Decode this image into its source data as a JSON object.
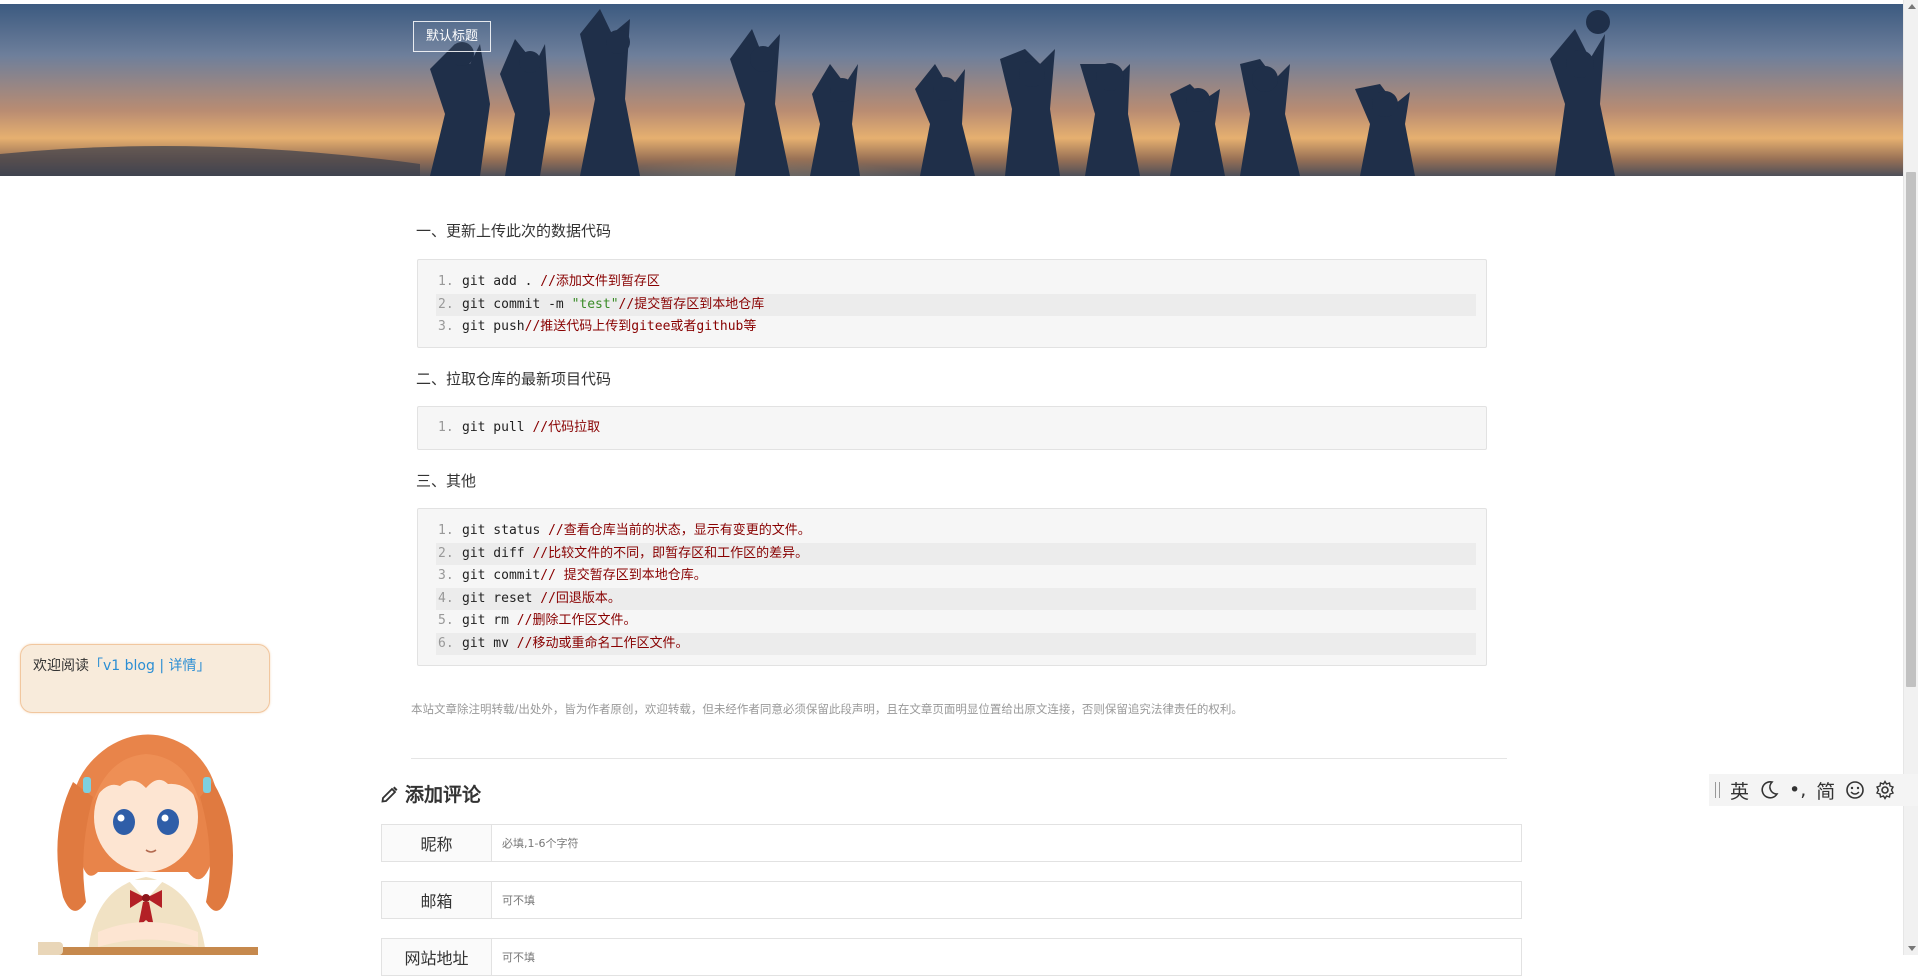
{
  "header": {
    "title_button": "默认标题"
  },
  "article": {
    "section1": {
      "heading": "一、更新上传此次的数据代码",
      "lines": [
        {
          "num": "1.",
          "code": "git add . ",
          "comment": "//添加文件到暂存区"
        },
        {
          "num": "2.",
          "code": "git commit -m ",
          "string": "\"test\"",
          "comment": "//提交暂存区到本地仓库"
        },
        {
          "num": "3.",
          "code": "git push",
          "comment": "//推送代码上传到gitee或者github等"
        }
      ]
    },
    "section2": {
      "heading": "二、拉取仓库的最新项目代码",
      "lines": [
        {
          "num": "1.",
          "code": "git pull ",
          "comment": "//代码拉取"
        }
      ]
    },
    "section3": {
      "heading": "三、其他",
      "lines": [
        {
          "num": "1.",
          "code": "git status ",
          "comment": "//查看仓库当前的状态，显示有变更的文件。"
        },
        {
          "num": "2.",
          "code": "git diff ",
          "comment": "//比较文件的不同，即暂存区和工作区的差异。"
        },
        {
          "num": "3.",
          "code": "git commit",
          "comment": "// 提交暂存区到本地仓库。"
        },
        {
          "num": "4.",
          "code": "git reset ",
          "comment": "//回退版本。"
        },
        {
          "num": "5.",
          "code": "git rm ",
          "comment": "//删除工作区文件。"
        },
        {
          "num": "6.",
          "code": "git mv ",
          "comment": "//移动或重命名工作区文件。"
        }
      ]
    },
    "copyright_notice": "本站文章除注明转载/出处外，皆为作者原创，欢迎转载，但未经作者同意必须保留此段声明，且在文章页面明显位置给出原文连接，否则保留追究法律责任的权利。"
  },
  "comment_form": {
    "title": "添加评论",
    "nickname_label": "昵称",
    "nickname_placeholder": "必填,1-6个字符",
    "email_label": "邮箱",
    "email_placeholder": "可不填",
    "website_label": "网站地址",
    "website_placeholder": "可不填"
  },
  "welcome_widget": {
    "prefix": "欢迎阅读",
    "link_text": "「v1 blog | 详情」"
  },
  "ime_toolbar": {
    "lang": "英",
    "moon_icon": "moon-icon",
    "punct": "•,",
    "charset": "简",
    "emoji_icon": "smiley-icon",
    "settings_icon": "gear-icon"
  }
}
